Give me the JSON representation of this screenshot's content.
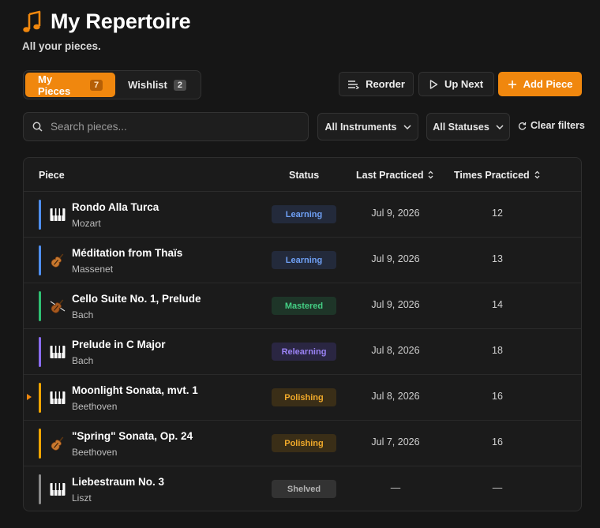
{
  "header": {
    "title": "My Repertoire",
    "subtitle": "All your pieces.",
    "icon": "music-note-icon"
  },
  "tabs": [
    {
      "label": "My Pieces",
      "count": "7",
      "active": true
    },
    {
      "label": "Wishlist",
      "count": "2",
      "active": false
    }
  ],
  "actions": {
    "reorder": "Reorder",
    "up_next": "Up Next",
    "add_piece": "Add Piece"
  },
  "search": {
    "placeholder": "Search pieces...",
    "value": ""
  },
  "filters": {
    "instruments": "All Instruments",
    "statuses": "All Statuses",
    "clear": "Clear filters"
  },
  "table": {
    "headers": {
      "piece": "Piece",
      "status": "Status",
      "last": "Last Practiced",
      "times": "Times Practiced"
    },
    "rows": [
      {
        "title": "Rondo Alla Turca",
        "composer": "Mozart",
        "instrument": "piano",
        "status": "Learning",
        "last": "Jul 9, 2026",
        "times": "12",
        "current": false
      },
      {
        "title": "Méditation from Thaïs",
        "composer": "Massenet",
        "instrument": "violin",
        "status": "Learning",
        "last": "Jul 9, 2026",
        "times": "13",
        "current": false
      },
      {
        "title": "Cello Suite No. 1, Prelude",
        "composer": "Bach",
        "instrument": "cello",
        "status": "Mastered",
        "last": "Jul 9, 2026",
        "times": "14",
        "current": false
      },
      {
        "title": "Prelude in C Major",
        "composer": "Bach",
        "instrument": "piano",
        "status": "Relearning",
        "last": "Jul 8, 2026",
        "times": "18",
        "current": false
      },
      {
        "title": "Moonlight Sonata, mvt. 1",
        "composer": "Beethoven",
        "instrument": "piano",
        "status": "Polishing",
        "last": "Jul 8, 2026",
        "times": "16",
        "current": true
      },
      {
        "title": "\"Spring\" Sonata, Op. 24",
        "composer": "Beethoven",
        "instrument": "violin",
        "status": "Polishing",
        "last": "Jul 7, 2026",
        "times": "16",
        "current": false
      },
      {
        "title": "Liebestraum No. 3",
        "composer": "Liszt",
        "instrument": "piano",
        "status": "Shelved",
        "last": "—",
        "times": "—",
        "current": false
      }
    ]
  },
  "colors": {
    "accent": "#f0870e",
    "Learning": {
      "bar": "#4f8ff0",
      "bg": "#232a3b",
      "fg": "#6fa0f5"
    },
    "Mastered": {
      "bar": "#2fbf72",
      "bg": "#1e3528",
      "fg": "#44cf84"
    },
    "Relearning": {
      "bar": "#8a6cf0",
      "bg": "#2a2642",
      "fg": "#9b83f5"
    },
    "Polishing": {
      "bar": "#f0a500",
      "bg": "#3a2e17",
      "fg": "#f0a92a"
    },
    "Shelved": {
      "bar": "#8a8a8a",
      "bg": "#333333",
      "fg": "#b3b3b3"
    }
  }
}
